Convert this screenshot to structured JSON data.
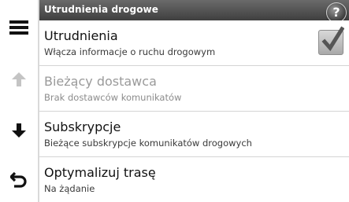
{
  "header": {
    "title": "Utrudnienia drogowe",
    "help_label": "?"
  },
  "rail": {
    "menu_icon": "hamburger-menu-icon",
    "up_icon": "arrow-up-icon",
    "down_icon": "arrow-down-icon",
    "back_icon": "back-arrow-icon"
  },
  "items": [
    {
      "title": "Utrudnienia",
      "subtitle": "Włącza informacje o ruchu drogowym",
      "checked": true,
      "disabled": false
    },
    {
      "title": "Bieżący dostawca",
      "subtitle": "Brak dostawców komunikatów",
      "disabled": true
    },
    {
      "title": "Subskrypcje",
      "subtitle": "Bieżące subskrypcje komunikatów drogowych",
      "disabled": false
    },
    {
      "title": "Optymalizuj trasę",
      "subtitle": "Na żądanie",
      "disabled": false
    }
  ],
  "colors": {
    "titlebar": "#4f4f4f",
    "text": "#111111",
    "disabled_text": "#9a9a9a",
    "divider": "#d4d4d4"
  }
}
